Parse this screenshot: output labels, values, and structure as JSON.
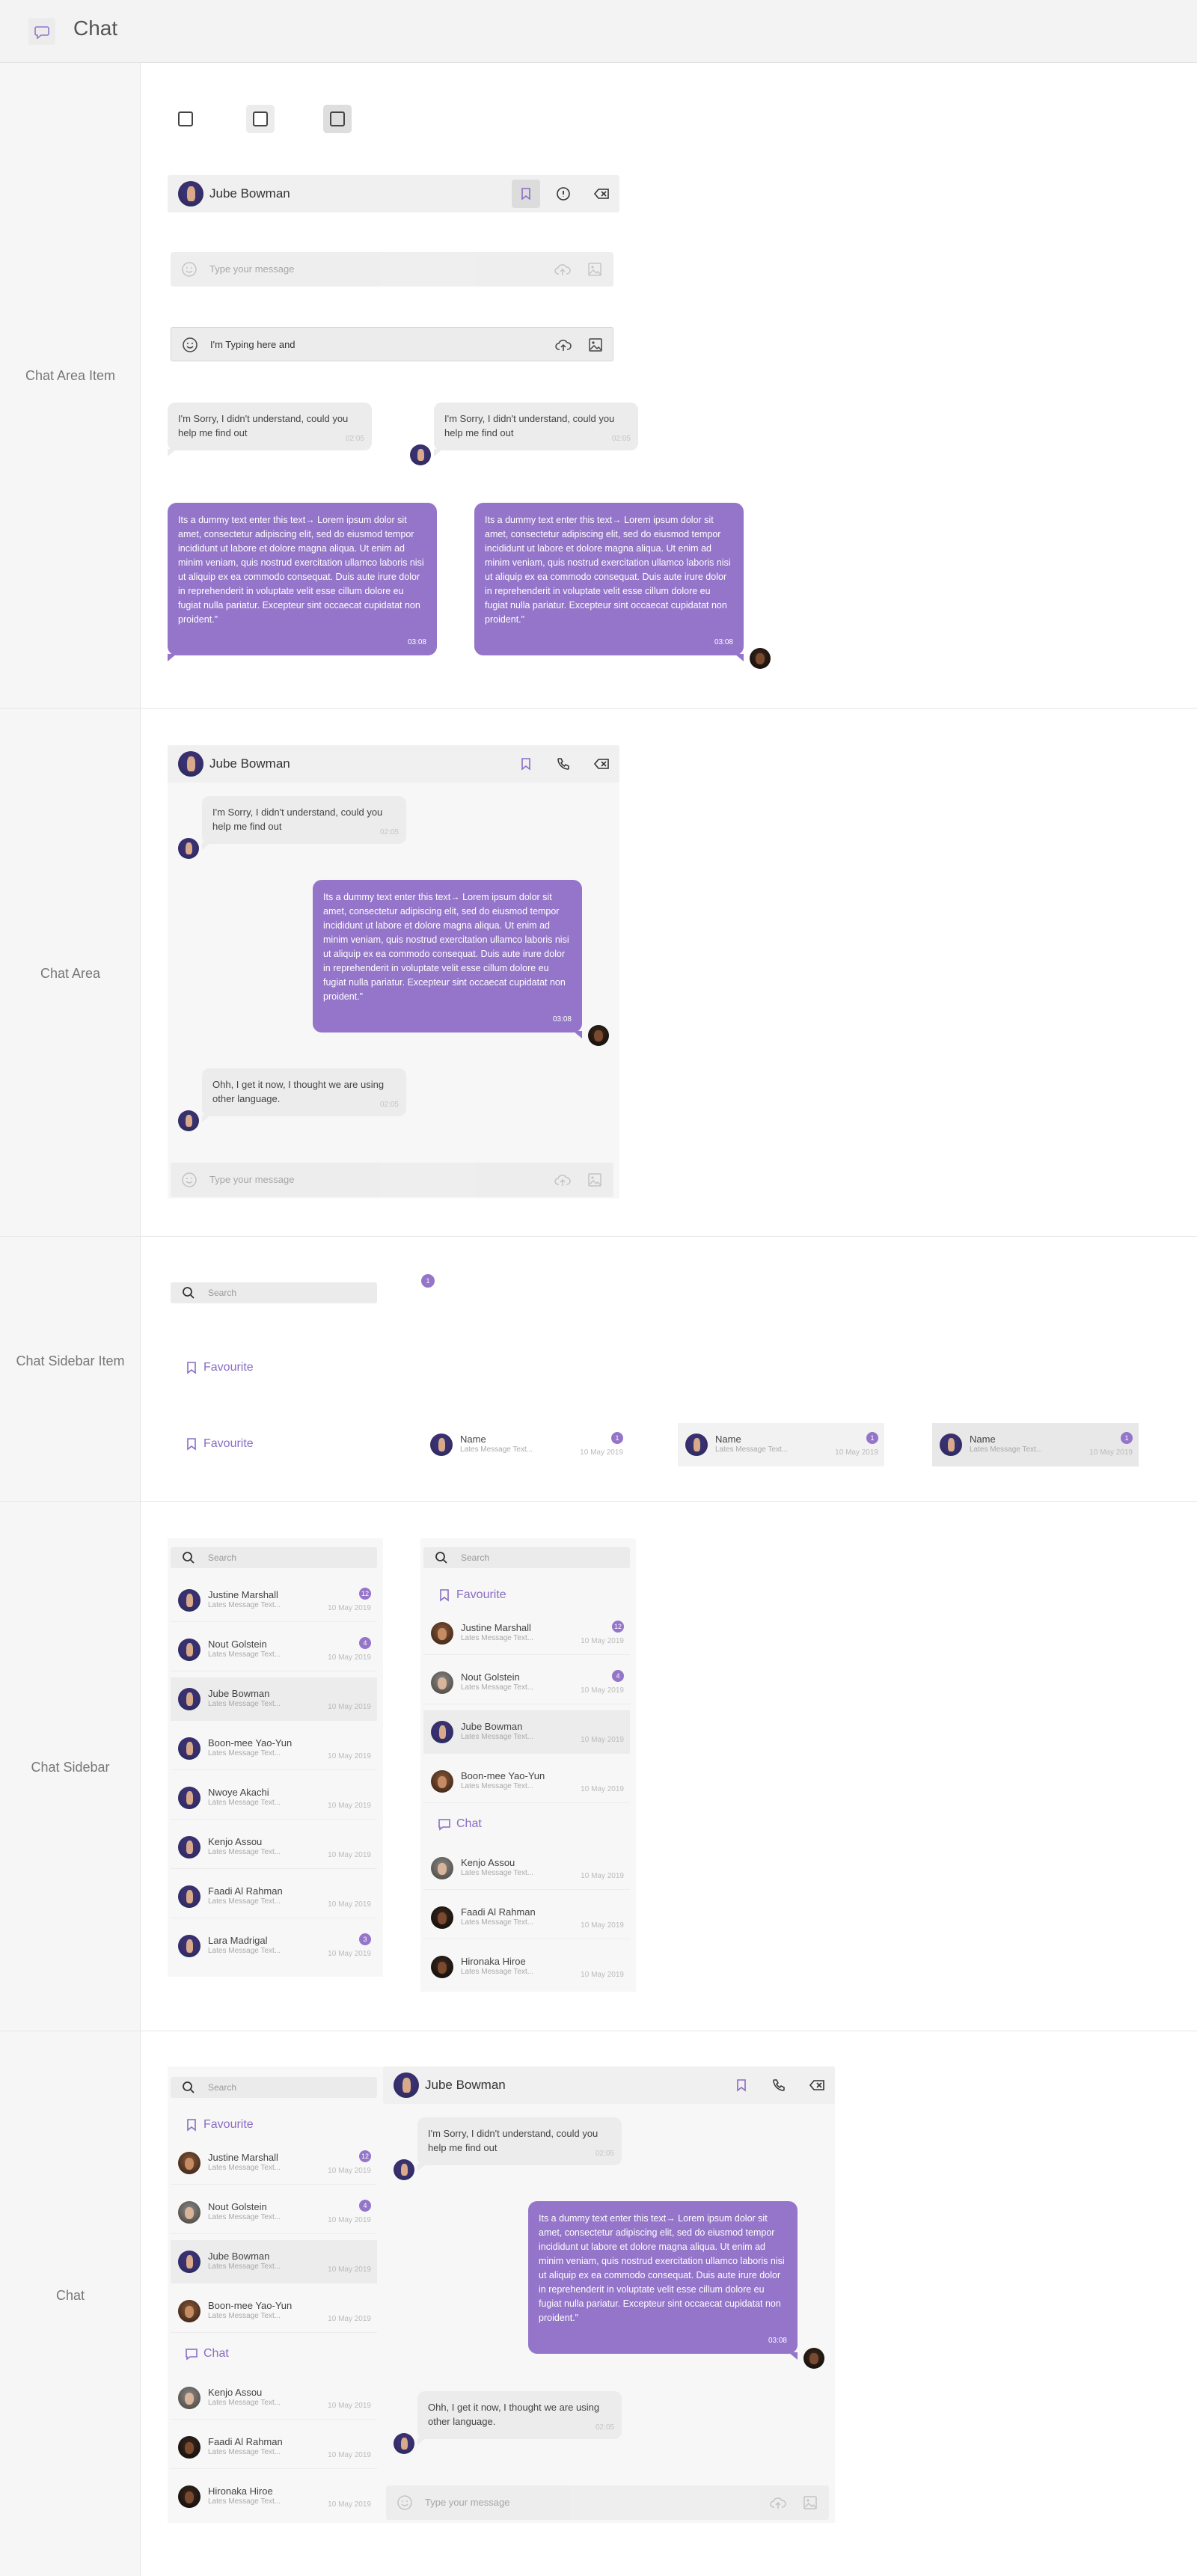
{
  "app": {
    "title": "Chat"
  },
  "sections": {
    "chat_area_item": "Chat Area Item",
    "chat_area": "Chat Area",
    "chat_sidebar_item": "Chat Sidebar Item",
    "chat_sidebar": "Chat Sidebar",
    "chat": "Chat"
  },
  "contact": {
    "name": "Jube Bowman"
  },
  "composer": {
    "placeholder": "Type your message",
    "typed": "I'm Typing here and"
  },
  "messages": {
    "sorry": "I'm Sorry, I didn't understand, could you help me find out",
    "dummy": "Its a dummy text enter this text→ Lorem ipsum dolor sit amet, consectetur adipiscing elit, sed do eiusmod tempor incididunt ut labore et dolore magna aliqua. Ut enim ad minim veniam, quis nostrud exercitation ullamco laboris nisi ut aliquip ex ea commodo consequat. Duis aute irure dolor in reprehenderit in voluptate velit esse cillum dolore eu fugiat nulla pariatur. Excepteur sint occaecat cupidatat non proident.\"",
    "ohh": "Ohh, I get it now, I thought we are using other language.",
    "time_g": "02:05",
    "time_p": "03:08"
  },
  "sidebar": {
    "search_placeholder": "Search",
    "favourite": "Favourite",
    "chat": "Chat",
    "preview": "Lates Message Text...",
    "date": "10 May 2019",
    "demo_name": "Name",
    "demo_badge": "1",
    "items": [
      {
        "name": "Justine Marshall",
        "badge": "12"
      },
      {
        "name": "Nout Golstein",
        "badge": "4"
      },
      {
        "name": "Jube Bowman",
        "badge": ""
      },
      {
        "name": "Boon-mee Yao-Yun",
        "badge": ""
      },
      {
        "name": "Nwoye Akachi",
        "badge": ""
      },
      {
        "name": "Kenjo Assou",
        "badge": ""
      },
      {
        "name": "Faadi Al Rahman",
        "badge": ""
      },
      {
        "name": "Lara Madrigal",
        "badge": "3"
      },
      {
        "name": "Hironaka Hiroe",
        "badge": ""
      }
    ]
  },
  "colors": {
    "accent": "#9475c9",
    "bubble": "#ececec"
  }
}
